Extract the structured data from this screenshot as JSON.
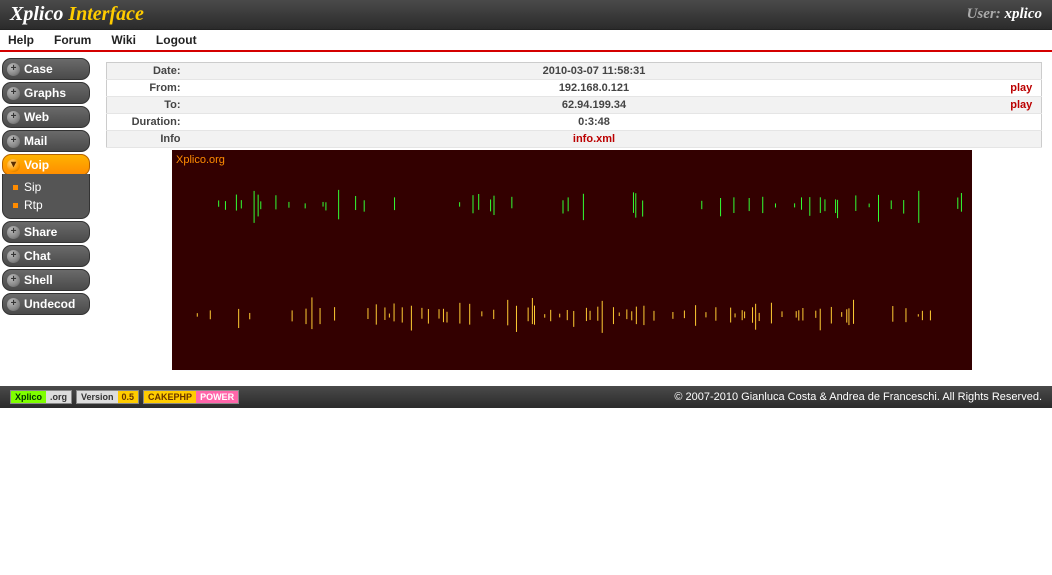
{
  "header": {
    "logo_left": "Xplico",
    "logo_right": "Interface",
    "user_label": "User:",
    "username": "xplico"
  },
  "topnav": [
    "Help",
    "Forum",
    "Wiki",
    "Logout"
  ],
  "sidebar": {
    "items": [
      {
        "label": "Case"
      },
      {
        "label": "Graphs"
      },
      {
        "label": "Web"
      },
      {
        "label": "Mail"
      },
      {
        "label": "Voip",
        "active": true,
        "children": [
          "Sip",
          "Rtp"
        ]
      },
      {
        "label": "Share"
      },
      {
        "label": "Chat"
      },
      {
        "label": "Shell"
      },
      {
        "label": "Undecod"
      }
    ]
  },
  "details": {
    "rows": [
      {
        "label": "Date:",
        "value": "2010-03-07 11:58:31",
        "action": ""
      },
      {
        "label": "From:",
        "value": "192.168.0.121",
        "action": "play"
      },
      {
        "label": "To:",
        "value": "62.94.199.34",
        "action": "play"
      },
      {
        "label": "Duration:",
        "value": "0:3:48",
        "action": ""
      },
      {
        "label": "Info",
        "value": "info.xml",
        "action": "",
        "link": true
      }
    ]
  },
  "waveform": {
    "label": "Xplico.org",
    "color_bg": "#330000",
    "color_top": "#33ff33",
    "color_bottom": "#ffcc33"
  },
  "footer": {
    "badges": [
      {
        "left": "Xplico",
        "right": ".org",
        "left_class": "b-green",
        "right_class": "b-grey"
      },
      {
        "left": "Version",
        "right": "0.5",
        "left_class": "b-grey",
        "right_class": "b-orange"
      },
      {
        "left": "CAKEPHP",
        "right": "POWER",
        "left_class": "b-orange",
        "right_class": "b-pink"
      }
    ],
    "copyright": "© 2007-2010 Gianluca Costa & Andrea de Franceschi. All Rights Reserved."
  }
}
